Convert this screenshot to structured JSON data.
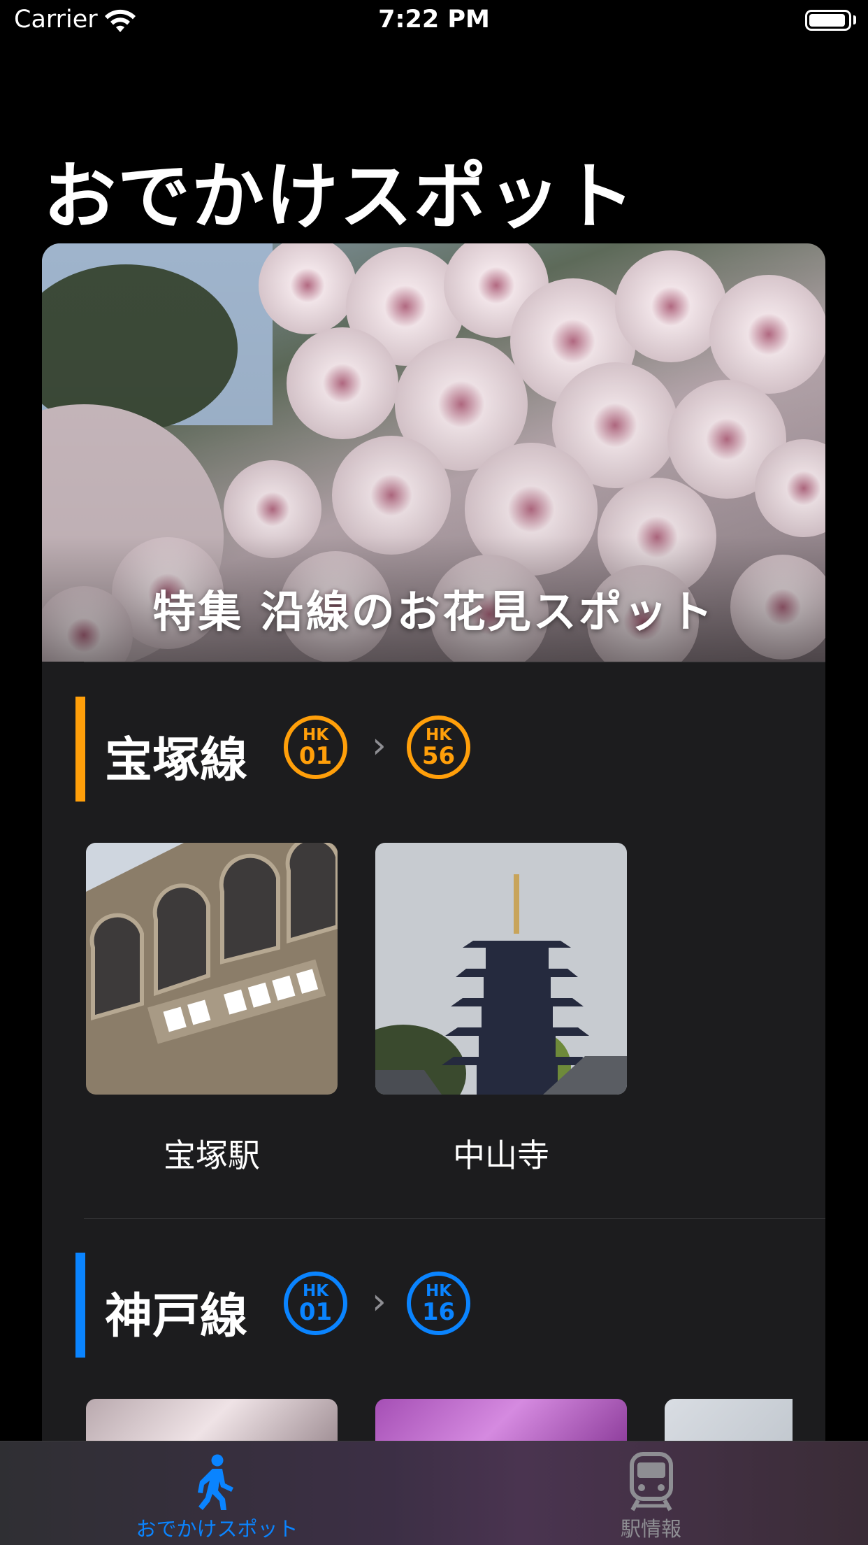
{
  "status_bar": {
    "carrier": "Carrier",
    "time": "7:22 PM",
    "battery_level": 0.95
  },
  "page_title": "おでかけスポット",
  "featured": {
    "title": "特集 沿線のお花見スポット"
  },
  "lines": [
    {
      "name": "宝塚線",
      "color": "#ff9f0a",
      "start": {
        "code": "HK",
        "number": "01"
      },
      "end": {
        "code": "HK",
        "number": "56"
      },
      "spots": [
        {
          "label": "宝塚駅"
        },
        {
          "label": "中山寺"
        }
      ]
    },
    {
      "name": "神戸線",
      "color": "#0a84ff",
      "start": {
        "code": "HK",
        "number": "01"
      },
      "end": {
        "code": "HK",
        "number": "16"
      },
      "spots": [
        {
          "label": ""
        },
        {
          "label": ""
        },
        {
          "label": ""
        }
      ]
    }
  ],
  "tab_bar": {
    "active_color": "#0a84ff",
    "inactive_color": "#8e8e93",
    "tabs": [
      {
        "label": "おでかけスポット",
        "icon": "walking-person-icon",
        "selected": true
      },
      {
        "label": "駅情報",
        "icon": "train-icon",
        "selected": false
      }
    ]
  }
}
